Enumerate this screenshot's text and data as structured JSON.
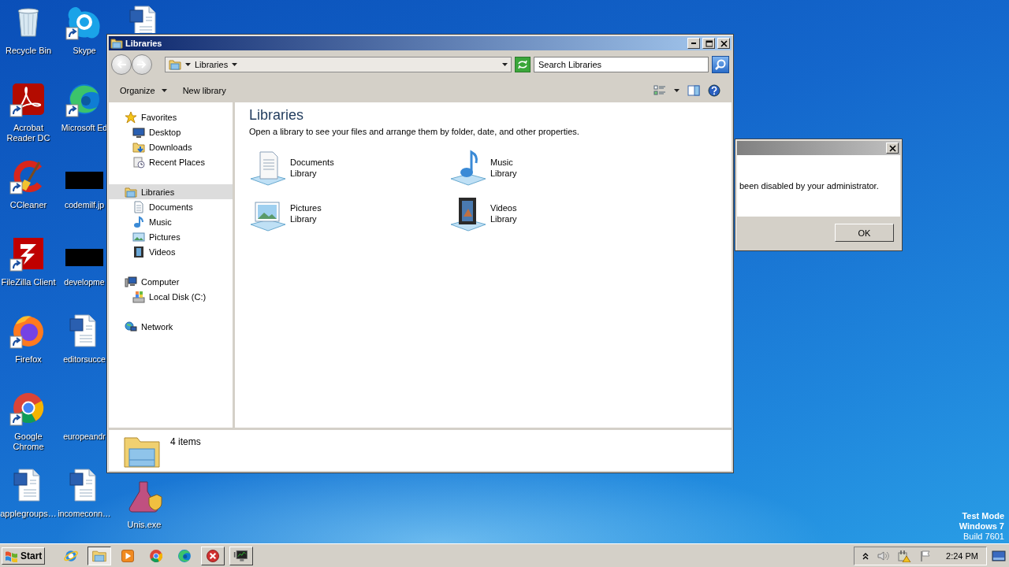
{
  "desktop": {
    "columns": [
      [
        {
          "label": "Recycle Bin",
          "kind": "recycle",
          "shortcut": false
        },
        {
          "label": "Acrobat Reader DC",
          "kind": "acrobat",
          "shortcut": true
        },
        {
          "label": "CCleaner",
          "kind": "ccleaner",
          "shortcut": true
        },
        {
          "label": "FileZilla Client",
          "kind": "filezilla",
          "shortcut": true
        },
        {
          "label": "Firefox",
          "kind": "firefox",
          "shortcut": true
        },
        {
          "label": "Google Chrome",
          "kind": "chrome",
          "shortcut": true
        },
        {
          "label": "applegroups…",
          "kind": "word",
          "shortcut": false
        }
      ],
      [
        {
          "label": "Skype",
          "kind": "skype",
          "shortcut": true
        },
        {
          "label": "Microsoft Ed",
          "kind": "edge",
          "shortcut": true
        },
        {
          "label": "codemilf.jp",
          "kind": "redacted",
          "shortcut": false
        },
        {
          "label": "developme",
          "kind": "redacted",
          "shortcut": false
        },
        {
          "label": "editorsucce",
          "kind": "word",
          "shortcut": false
        },
        {
          "label": "europeandr",
          "kind": "blank"
        },
        {
          "label": "incomeconn…",
          "kind": "word",
          "shortcut": false
        }
      ],
      [
        {
          "kind": "word",
          "shortcut": false
        },
        {
          "label": "Unis.exe",
          "kind": "exe",
          "shortcut": false
        }
      ]
    ],
    "system_notice": [
      "Test Mode",
      "Windows 7",
      "Build 7601"
    ]
  },
  "explorer": {
    "title": "Libraries",
    "back": {
      "disabled": true
    },
    "forward": {
      "disabled": true
    },
    "address": "Libraries",
    "search": {
      "placeholder": "Search Libraries"
    },
    "toolbar": [
      {
        "label": "Organize",
        "dropdown": true
      },
      {
        "label": "New library",
        "dropdown": false
      }
    ],
    "navigation": [
      {
        "label": "Favorites",
        "kind": "star",
        "selected": false,
        "children": [
          {
            "label": "Desktop",
            "kind": "desktop",
            "selected": false
          },
          {
            "label": "Downloads",
            "kind": "downloads",
            "selected": false
          },
          {
            "label": "Recent Places",
            "kind": "recent",
            "selected": false
          }
        ]
      },
      {
        "label": "Libraries",
        "kind": "libraries",
        "selected": true,
        "children": [
          {
            "label": "Documents",
            "kind": "documents",
            "selected": false
          },
          {
            "label": "Music",
            "kind": "music",
            "selected": false
          },
          {
            "label": "Pictures",
            "kind": "pictures",
            "selected": false
          },
          {
            "label": "Videos",
            "kind": "videos",
            "selected": false
          }
        ]
      },
      {
        "label": "Computer",
        "kind": "computer",
        "selected": false,
        "children": [
          {
            "label": "Local Disk (C:)",
            "kind": "disk",
            "selected": false
          }
        ]
      },
      {
        "label": "Network",
        "kind": "network",
        "selected": false
      }
    ],
    "heading": "Libraries",
    "description": "Open a library to see your files and arrange them by folder, date, and other properties.",
    "libraries": [
      {
        "name": "Documents",
        "type": "Library",
        "kind": "documents"
      },
      {
        "name": "Music",
        "type": "Library",
        "kind": "music"
      },
      {
        "name": "Pictures",
        "type": "Library",
        "kind": "pictures"
      },
      {
        "name": "Videos",
        "type": "Library",
        "kind": "videos"
      }
    ],
    "details": {
      "count": "4 items"
    }
  },
  "dialog": {
    "message": "been disabled by your administrator.",
    "buttons": [
      "OK"
    ]
  },
  "taskbar": {
    "start": "Start",
    "items": [
      {
        "kind": "ie",
        "running": false,
        "selected": false
      },
      {
        "kind": "explorer",
        "running": true,
        "selected": true
      },
      {
        "kind": "media",
        "running": false,
        "selected": false
      },
      {
        "kind": "chrome",
        "running": false,
        "selected": false
      },
      {
        "kind": "edge",
        "running": false,
        "selected": false
      },
      {
        "kind": "error",
        "running": true,
        "selected": false
      },
      {
        "kind": "monitor",
        "running": true,
        "selected": false
      }
    ],
    "clock": "2:24 PM"
  }
}
